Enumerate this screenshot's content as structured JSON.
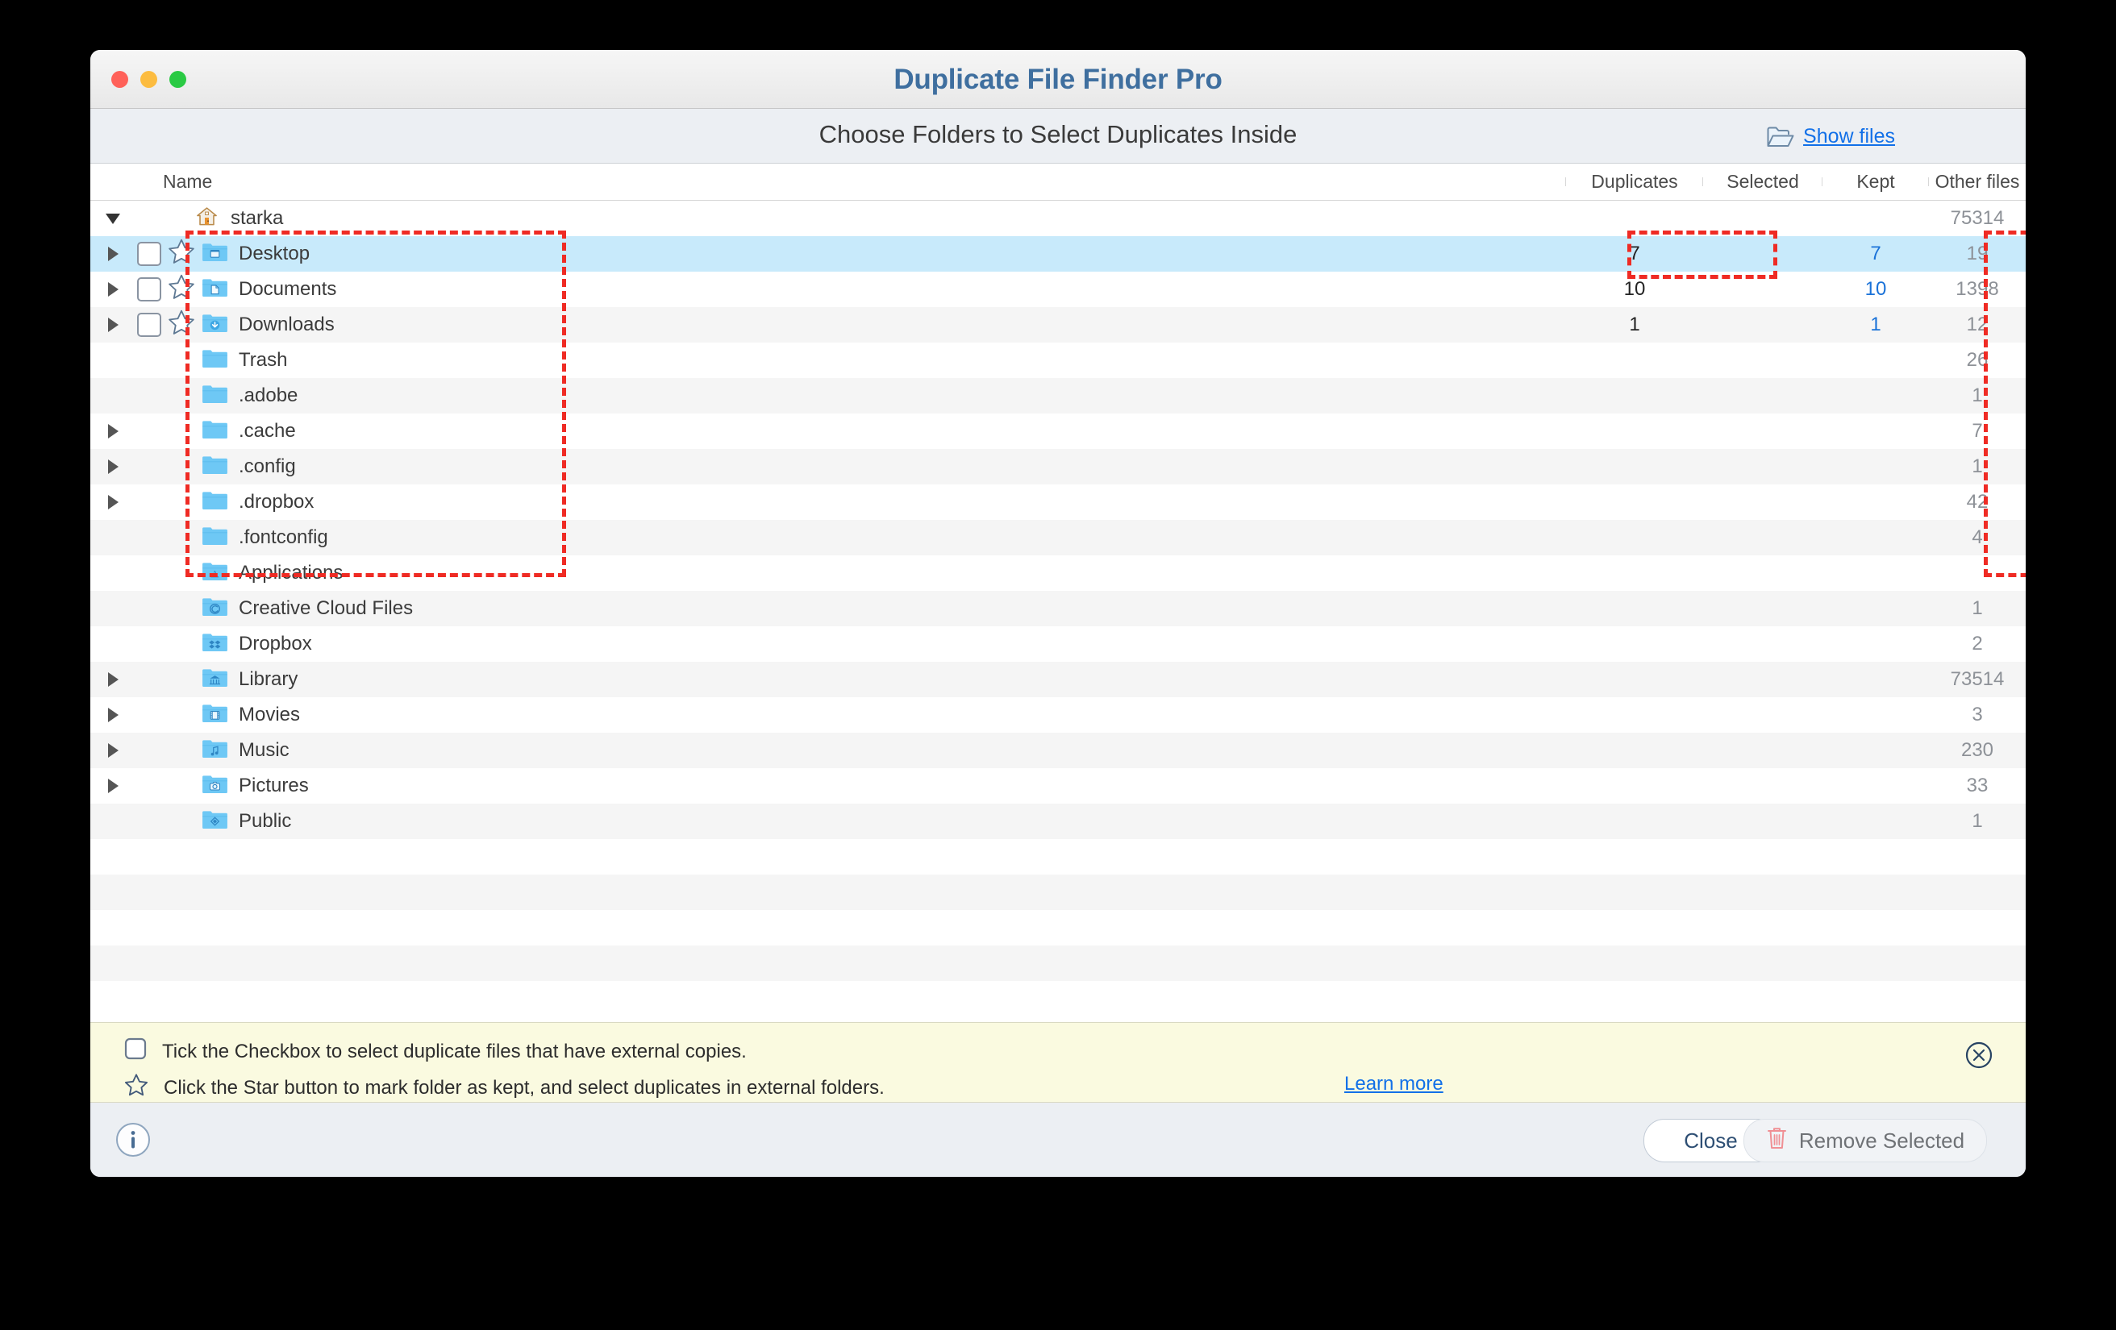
{
  "window": {
    "title": "Duplicate File Finder Pro",
    "traffic_lights": {
      "close_color": "#ff6159",
      "minimize_color": "#fcbc40",
      "maximize_color": "#2aca44"
    }
  },
  "header": {
    "subtitle": "Choose Folders to Select Duplicates Inside",
    "show_files_label": "Show files",
    "link_color": "#1270e8"
  },
  "table": {
    "columns": [
      {
        "key": "name",
        "label": "Name"
      },
      {
        "key": "duplicates",
        "label": "Duplicates"
      },
      {
        "key": "selected",
        "label": "Selected"
      },
      {
        "key": "kept",
        "label": "Kept"
      },
      {
        "key": "other",
        "label": "Other files"
      }
    ],
    "rows": [
      {
        "name": "starka",
        "icon": "home-folder-icon",
        "indent": 0,
        "twisty": "down",
        "checkbox": false,
        "star": false,
        "duplicates": "",
        "selected": "",
        "kept": "",
        "other": "75314",
        "highlighted": false
      },
      {
        "name": "Desktop",
        "icon": "desktop-folder-icon",
        "indent": 1,
        "twisty": "right",
        "checkbox": true,
        "star": true,
        "duplicates": "7",
        "selected": "",
        "kept": "7",
        "other": "19",
        "highlighted": true
      },
      {
        "name": "Documents",
        "icon": "documents-folder-icon",
        "indent": 1,
        "twisty": "right",
        "checkbox": true,
        "star": true,
        "duplicates": "10",
        "selected": "",
        "kept": "10",
        "other": "1398",
        "highlighted": false
      },
      {
        "name": "Downloads",
        "icon": "downloads-folder-icon",
        "indent": 1,
        "twisty": "right",
        "checkbox": true,
        "star": true,
        "duplicates": "1",
        "selected": "",
        "kept": "1",
        "other": "12",
        "highlighted": false
      },
      {
        "name": "Trash",
        "icon": "plain-folder-icon",
        "indent": 1,
        "twisty": "none",
        "checkbox": false,
        "star": false,
        "duplicates": "",
        "selected": "",
        "kept": "",
        "other": "26",
        "highlighted": false
      },
      {
        "name": ".adobe",
        "icon": "plain-folder-icon",
        "indent": 1,
        "twisty": "none",
        "checkbox": false,
        "star": false,
        "duplicates": "",
        "selected": "",
        "kept": "",
        "other": "1",
        "highlighted": false
      },
      {
        "name": ".cache",
        "icon": "plain-folder-icon",
        "indent": 1,
        "twisty": "right",
        "checkbox": false,
        "star": false,
        "duplicates": "",
        "selected": "",
        "kept": "",
        "other": "7",
        "highlighted": false
      },
      {
        "name": ".config",
        "icon": "plain-folder-icon",
        "indent": 1,
        "twisty": "right",
        "checkbox": false,
        "star": false,
        "duplicates": "",
        "selected": "",
        "kept": "",
        "other": "1",
        "highlighted": false
      },
      {
        "name": ".dropbox",
        "icon": "plain-folder-icon",
        "indent": 1,
        "twisty": "right",
        "checkbox": false,
        "star": false,
        "duplicates": "",
        "selected": "",
        "kept": "",
        "other": "42",
        "highlighted": false
      },
      {
        "name": ".fontconfig",
        "icon": "plain-folder-icon",
        "indent": 1,
        "twisty": "none",
        "checkbox": false,
        "star": false,
        "duplicates": "",
        "selected": "",
        "kept": "",
        "other": "4",
        "highlighted": false
      },
      {
        "name": "Applications",
        "icon": "applications-folder-icon",
        "indent": 1,
        "twisty": "none",
        "checkbox": false,
        "star": false,
        "duplicates": "",
        "selected": "",
        "kept": "",
        "other": "",
        "highlighted": false
      },
      {
        "name": "Creative Cloud Files",
        "icon": "creativecloud-folder-icon",
        "indent": 1,
        "twisty": "none",
        "checkbox": false,
        "star": false,
        "duplicates": "",
        "selected": "",
        "kept": "",
        "other": "1",
        "highlighted": false
      },
      {
        "name": "Dropbox",
        "icon": "dropbox-folder-icon",
        "indent": 1,
        "twisty": "none",
        "checkbox": false,
        "star": false,
        "duplicates": "",
        "selected": "",
        "kept": "",
        "other": "2",
        "highlighted": false
      },
      {
        "name": "Library",
        "icon": "library-folder-icon",
        "indent": 1,
        "twisty": "right",
        "checkbox": false,
        "star": false,
        "duplicates": "",
        "selected": "",
        "kept": "",
        "other": "73514",
        "highlighted": false
      },
      {
        "name": "Movies",
        "icon": "movies-folder-icon",
        "indent": 1,
        "twisty": "right",
        "checkbox": false,
        "star": false,
        "duplicates": "",
        "selected": "",
        "kept": "",
        "other": "3",
        "highlighted": false
      },
      {
        "name": "Music",
        "icon": "music-folder-icon",
        "indent": 1,
        "twisty": "right",
        "checkbox": false,
        "star": false,
        "duplicates": "",
        "selected": "",
        "kept": "",
        "other": "230",
        "highlighted": false
      },
      {
        "name": "Pictures",
        "icon": "pictures-folder-icon",
        "indent": 1,
        "twisty": "right",
        "checkbox": false,
        "star": false,
        "duplicates": "",
        "selected": "",
        "kept": "",
        "other": "33",
        "highlighted": false
      },
      {
        "name": "Public",
        "icon": "public-folder-icon",
        "indent": 1,
        "twisty": "none",
        "checkbox": false,
        "star": false,
        "duplicates": "",
        "selected": "",
        "kept": "",
        "other": "1",
        "highlighted": false
      }
    ],
    "empty_row_count": 5,
    "selected_row_color": "#c8eafb",
    "kept_value_color": "#1a72d8",
    "other_value_color": "#8d9197"
  },
  "hint_bar": {
    "background": "#fafae0",
    "checkbox_hint": "Tick the Checkbox to select duplicate files that have external copies.",
    "star_hint": "Click the Star button to mark folder as kept, and select duplicates in external folders.",
    "learn_more_label": "Learn more"
  },
  "footer": {
    "close_label": "Close",
    "remove_label": "Remove Selected",
    "trash_icon_color": "#f08f94"
  },
  "annotations": {
    "box_color": "#ef2b24",
    "boxes": [
      {
        "name": "name-column-highlight"
      },
      {
        "name": "duplicates-column-highlight"
      },
      {
        "name": "other-files-column-highlight"
      }
    ]
  }
}
